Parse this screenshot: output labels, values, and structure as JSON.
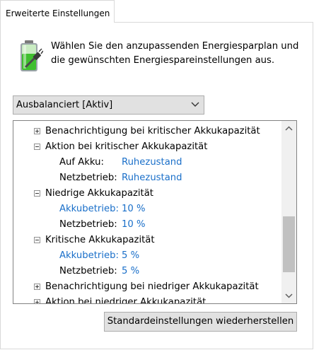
{
  "tab": {
    "label": "Erweiterte Einstellungen"
  },
  "intro": {
    "text": "Wählen Sie den anzupassenden Energiesparplan und die gewünschten Energiespareinstellungen aus."
  },
  "plan_select": {
    "value": "Ausbalanciert [Aktiv]"
  },
  "tree": {
    "items": [
      {
        "label": "Benachrichtigung bei kritischer Akkukapazität",
        "expanded": false
      },
      {
        "label": "Aktion bei kritischer Akkukapazität",
        "expanded": true
      },
      {
        "label": "Auf Akku:",
        "value": "Ruhezustand"
      },
      {
        "label": "Netzbetrieb:",
        "value": "Ruhezustand"
      },
      {
        "label": "Niedrige Akkukapazität",
        "expanded": true
      },
      {
        "label": "Akkubetrieb:",
        "value": "10 %"
      },
      {
        "label": "Netzbetrieb:",
        "value": "10 %"
      },
      {
        "label": "Kritische Akkukapazität",
        "expanded": true
      },
      {
        "label": "Akkubetrieb:",
        "value": "5 %"
      },
      {
        "label": "Netzbetrieb:",
        "value": "5 %"
      },
      {
        "label": "Benachrichtigung bei niedriger Akkukapazität",
        "expanded": false
      },
      {
        "label": "Aktion bei niedriger Akkukapazität",
        "expanded": false
      }
    ]
  },
  "buttons": {
    "restore_label": "Standardeinstellungen wiederherstellen"
  },
  "icons": {
    "battery": "battery-plug-icon",
    "dropdown": "chevron-down-icon",
    "scroll_up": "scroll-up-arrow-icon",
    "scroll_down": "scroll-down-arrow-icon",
    "collapsed": "plus-box-icon",
    "expanded": "minus-box-icon"
  },
  "colors": {
    "link": "#1a6fc9",
    "battery_green": "#3fbf2e"
  }
}
